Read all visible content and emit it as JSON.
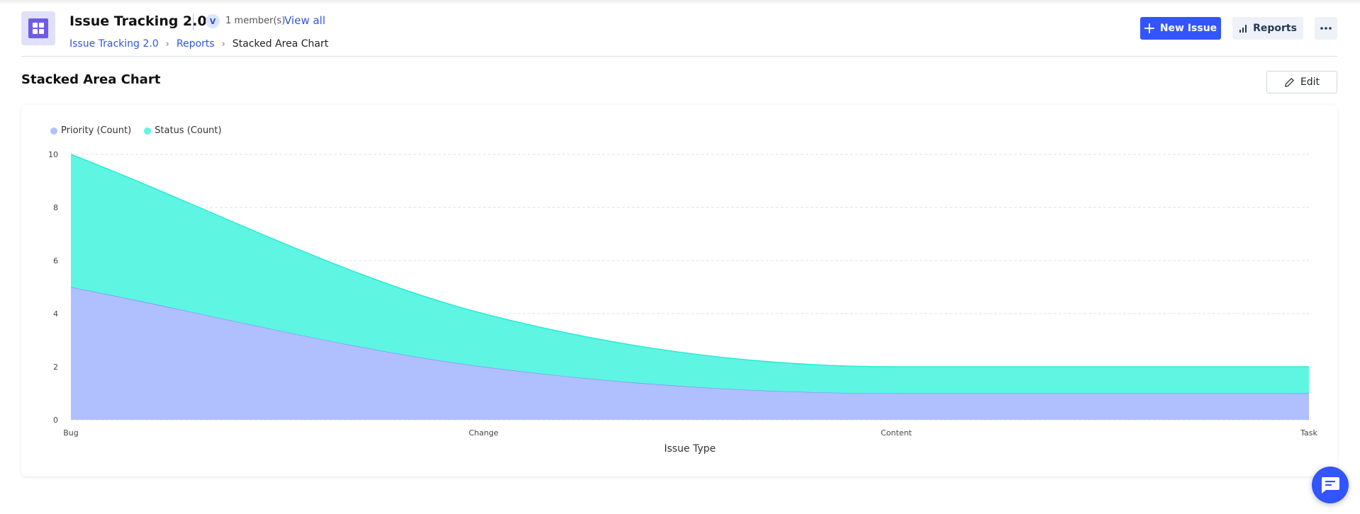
{
  "header": {
    "project_title": "Issue Tracking 2.0",
    "avatar_initial": "V",
    "members_text": "1 member(s)",
    "view_all_label": "View all",
    "breadcrumb": [
      "Issue Tracking 2.0",
      "Reports",
      "Stacked Area Chart"
    ],
    "new_issue_label": "New Issue",
    "reports_label": "Reports",
    "more_icon": "more-horizontal-icon"
  },
  "page": {
    "heading": "Stacked Area Chart",
    "edit_label": "Edit"
  },
  "colors": {
    "accent": "#3355ff",
    "link": "#2f55e0",
    "app_icon": "#6e5ce6"
  },
  "chart_data": {
    "type": "area",
    "stacked": true,
    "title": "Stacked Area Chart",
    "xlabel": "Issue Type",
    "ylabel": "",
    "categories": [
      "Bug",
      "Change",
      "Content",
      "Task"
    ],
    "ylim": [
      0,
      10
    ],
    "yticks": [
      0,
      2,
      4,
      6,
      8,
      10
    ],
    "grid": true,
    "legend_position": "top-left",
    "series": [
      {
        "name": "Priority (Count)",
        "values": [
          5,
          2,
          1,
          1
        ],
        "fill": "#b0bffd",
        "stroke": "#7d8ff8"
      },
      {
        "name": "Status (Count)",
        "values": [
          5,
          2,
          1,
          1
        ],
        "fill": "#5ef5e2",
        "stroke": "#1de9d4"
      }
    ]
  }
}
